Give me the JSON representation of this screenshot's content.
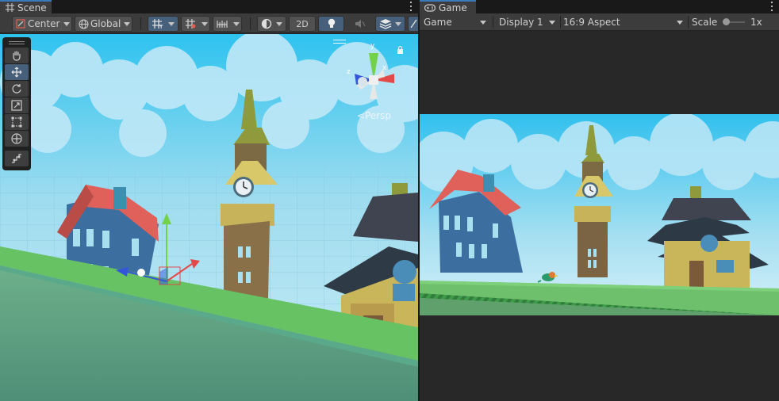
{
  "scene_panel": {
    "tab_title": "Scene",
    "pivot_mode": "Center",
    "pivot_rotation": "Global",
    "toggle_2d": "2D",
    "projection_label": "Persp",
    "gizmo_axes": {
      "x": "x",
      "y": "y",
      "z": "z"
    }
  },
  "game_panel": {
    "tab_title": "Game",
    "view_mode": "Game",
    "display": "Display 1",
    "aspect": "16:9 Aspect",
    "scale_label": "Scale",
    "scale_value": "1x"
  },
  "colors": {
    "accent": "#3a79bb",
    "sky": "#7fd3f2",
    "ground_green": "#6cc46a",
    "house_blue": "#3d6ea0",
    "roof_red": "#e0605a"
  }
}
